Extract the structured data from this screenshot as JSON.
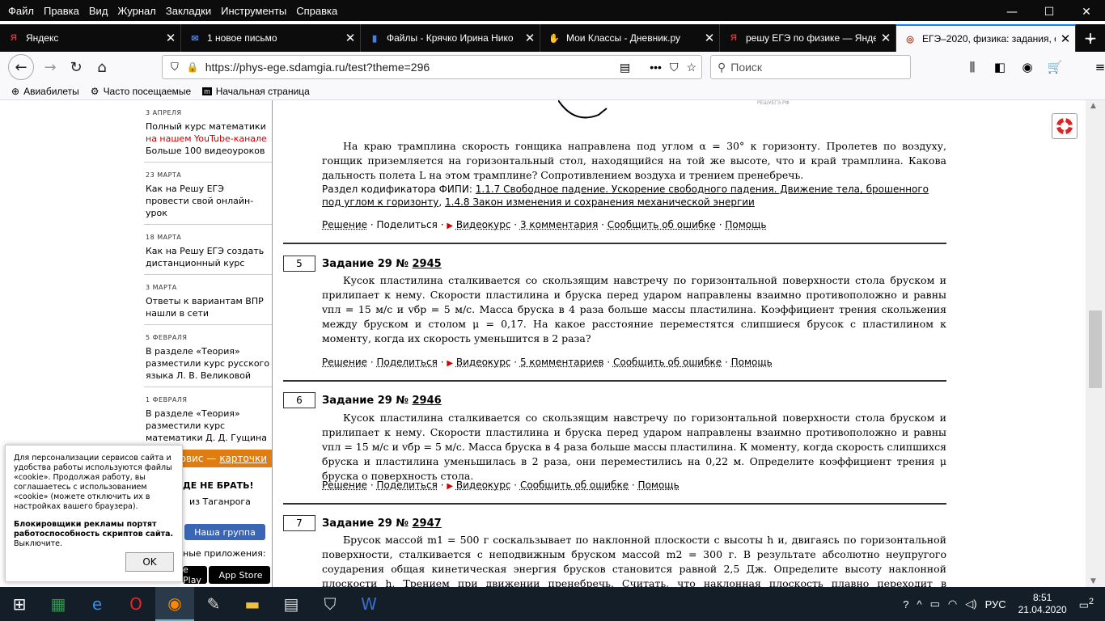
{
  "menu": [
    "Файл",
    "Правка",
    "Вид",
    "Журнал",
    "Закладки",
    "Инструменты",
    "Справка"
  ],
  "tabs": [
    {
      "label": "Яндекс",
      "icon": "Я",
      "color": "#e00"
    },
    {
      "label": "1 новое письмо",
      "icon": "✉",
      "color": "#36c"
    },
    {
      "label": "Файлы - Крячко Ирина Нико",
      "icon": "■",
      "color": "#36c"
    },
    {
      "label": "Мои Классы - Дневник.ру",
      "icon": "✋",
      "color": "#888"
    },
    {
      "label": "решу ЕГЭ по физике — Яндек",
      "icon": "Я",
      "color": "#e00"
    },
    {
      "label": "ЕГЭ–2020, физика: задания, о",
      "icon": "◎",
      "color": "#a43"
    }
  ],
  "nav": {
    "url": "https://phys-ege.sdamgia.ru/test?theme=296",
    "search_placeholder": "Поиск"
  },
  "bookmarks": [
    "Авиабилеты",
    "Часто посещаемые",
    "Начальная страница"
  ],
  "sidebar": {
    "news": [
      {
        "date": "3 АПРЕЛЯ",
        "lines": [
          "Полный курс математики"
        ],
        "red": "на нашем YouTube-канале",
        "tail": "Больше 100 видеоуроков"
      },
      {
        "date": "23 МАРТА",
        "lines": [
          "Как на Решу ЕГЭ",
          "провести свой онлайн-",
          "урок"
        ]
      },
      {
        "date": "18 МАРТА",
        "lines": [
          "Как на Решу ЕГЭ создать",
          "дистанционный курс"
        ]
      },
      {
        "date": "3 МАРТА",
        "lines": [
          "Ответы к вариантам ВПР",
          "нашли в сети"
        ]
      },
      {
        "date": "5 ФЕВРАЛЯ",
        "lines": [
          "В разделе «Теория»",
          "разместили курс русского",
          "языка Л. В. Великовой"
        ]
      },
      {
        "date": "1 ФЕВРАЛЯ",
        "lines": [
          "В разделе «Теория»",
          "разместили курс",
          "математики Д. Д. Гущина"
        ]
      }
    ],
    "orange_text": "ервис —",
    "orange_link": "карточки",
    "bold_line": "ДЕ НЕ БРАТЬ!",
    "city_line": "из Таганрога",
    "group_button": "Наша группа",
    "apps_line": "ные приложения:",
    "store1": "e Play",
    "store2": "App Store"
  },
  "cookie": {
    "text": "Для персонализации сервисов сайта и удобства работы используются файлы «cookie». Продолжая работу, вы соглашаетесь с использованием «cookie» (можете отключить их в настройках вашего браузера).",
    "bold": "Блокировщики рекламы портят работоспособность скриптов сайта.",
    "tail": "Выключите.",
    "ok": "OK"
  },
  "watermark": "РЕШУЕГЭ.РФ",
  "task4": {
    "text": "На краю трамплина скорость гонщика направлена под углом α = 30° к горизонту. Пролетев по воздуху, гонщик приземляется на горизонтальный стол, находящийся на той же высоте, что и край трамплина. Какова дальность полета L на этом трамплине? Сопротивлением воздуха и трением пренебречь.",
    "codifier_label": "Раздел кодификатора ФИПИ:",
    "cod1": "1.1.7 Свободное падение. Ускорение свободного падения. Движение тела, брошенного под углом к горизонту",
    "cod2": "1.4.8 Закон изменения и сохранения механической энергии",
    "actions": {
      "solution": "Решение",
      "share": "Поделиться",
      "video": "Видеокурс",
      "comments": "3 комментария",
      "report": "Сообщить об ошибке",
      "help": "Помощь"
    }
  },
  "task5": {
    "num": "5",
    "title": "Задание 29 №",
    "id": "2945",
    "text": "Кусок пластилина сталкивается со скользящим навстречу по горизонтальной поверхности стола бруском и прилипает к нему. Скорости пластилина и бруска перед ударом направлены взаимно противоположно и равны vпл = 15 м/с и vбр = 5 м/с. Масса бруска в 4 раза больше массы пластилина. Коэффициент трения скольжения между бруском и столом μ = 0,17. На какое расстояние переместятся слипшиеся брусок с пластилином к моменту, когда их скорость уменьшится в 2 раза?",
    "actions": {
      "solution": "Решение",
      "share": "Поделиться",
      "video": "Видеокурс",
      "comments": "5 комментариев",
      "report": "Сообщить об ошибке",
      "help": "Помощь"
    }
  },
  "task6": {
    "num": "6",
    "title": "Задание 29 №",
    "id": "2946",
    "text": "Кусок пластилина сталкивается со скользящим навстречу по горизонтальной поверхности стола бруском и прилипает к нему. Скорости пластилина и бруска перед ударом направлены взаимно противоположно и равны vпл = 15 м/с и vбр = 5 м/с. Масса бруска в 4 раза больше массы пластилина. К моменту, когда скорость слипшихся бруска и пластилина уменьшилась в 2 раза, они переместились на 0,22 м. Определите коэффициент трения μ бруска о поверхность стола.",
    "actions": {
      "solution": "Решение",
      "share": "Поделиться",
      "video": "Видеокурс",
      "report": "Сообщить об ошибке",
      "help": "Помощь"
    }
  },
  "task7": {
    "num": "7",
    "title": "Задание 29 №",
    "id": "2947",
    "text": "Брусок массой m1 = 500 г соскальзывает по наклонной плоскости с высоты h и, двигаясь по горизонтальной поверхности, сталкивается с неподвижным бруском массой m2 = 300 г. В результате абсолютно неупругого соударения общая кинетическая энергия брусков становится равной 2,5 Дж. Определите высоту наклонной плоскости h. Трением при движении пренебречь. Считать, что наклонная плоскость плавно переходит в горизонтальную."
  },
  "tray": {
    "lang": "РУС",
    "time": "8:51",
    "date": "21.04.2020",
    "notif": "2"
  }
}
